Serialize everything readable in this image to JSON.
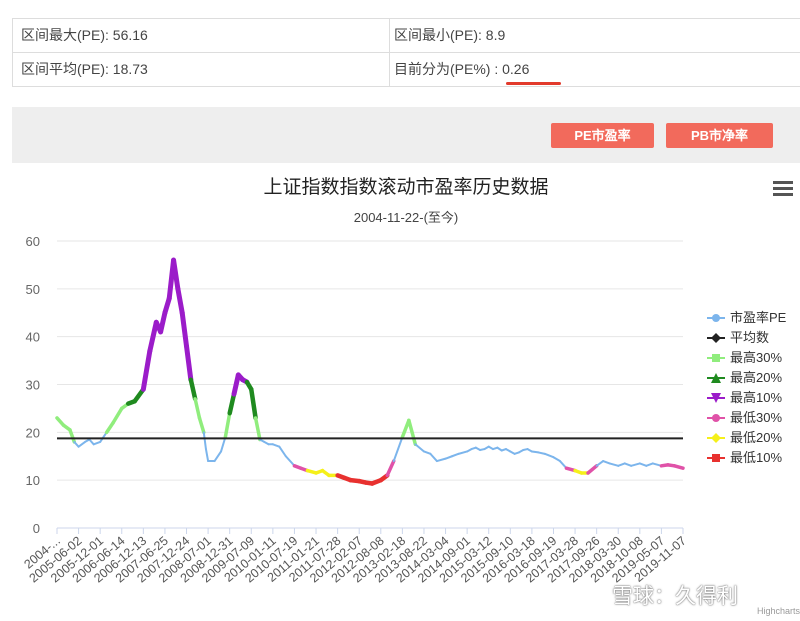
{
  "stats": {
    "max": "区间最大(PE): 56.16",
    "min": "区间最小(PE): 8.9",
    "avg": "区间平均(PE): 18.73",
    "current_label": "目前分为(PE%) : ",
    "current_value": "0.26"
  },
  "buttons": {
    "pe": "PE市盈率",
    "pb": "PB市净率"
  },
  "watermark": "雪球：久得利",
  "credit": "Highcharts.com",
  "colors": {
    "pe": "#7cb5ec",
    "avg": "#222222",
    "top30": "#90ed7d",
    "top20": "#1f8a1f",
    "top10": "#9b1cc9",
    "low30": "#e052a8",
    "low20": "#f5f01a",
    "low10": "#e8312f",
    "accent": "#f26a5c"
  },
  "chart_data": {
    "type": "line",
    "title": "上证指数指数滚动市盈率历史数据",
    "subtitle": "2004-11-22-(至今)",
    "ylim": [
      0,
      60
    ],
    "yticks": [
      0,
      10,
      20,
      30,
      40,
      50,
      60
    ],
    "xticks": [
      "2004-...",
      "2005-06-02",
      "2005-12-01",
      "2006-06-14",
      "2006-12-13",
      "2007-06-25",
      "2007-12-24",
      "2008-07-01",
      "2008-12-31",
      "2009-07-09",
      "2010-01-11",
      "2010-07-19",
      "2011-01-21",
      "2011-07-28",
      "2012-02-07",
      "2012-08-08",
      "2013-02-18",
      "2013-08-22",
      "2014-03-04",
      "2014-09-01",
      "2015-03-12",
      "2015-09-10",
      "2016-03-18",
      "2016-09-19",
      "2017-03-28",
      "2017-09-26",
      "2018-03-30",
      "2018-10-08",
      "2019-05-07",
      "2019-11-07"
    ],
    "average": 18.73,
    "grid": true,
    "legend_placement": "right",
    "series": [
      {
        "name": "市盈率PE",
        "x": [
          0,
          0.3,
          0.6,
          0.8,
          1,
          1.3,
          1.5,
          1.7,
          2,
          2.3,
          2.6,
          3,
          3.3,
          3.6,
          4,
          4.3,
          4.6,
          4.8,
          5,
          5.2,
          5.4,
          5.6,
          5.8,
          6,
          6.2,
          6.4,
          6.6,
          6.8,
          6.9,
          7,
          7.3,
          7.6,
          7.8,
          8,
          8.2,
          8.4,
          8.6,
          8.8,
          9,
          9.2,
          9.4,
          9.6,
          9.8,
          10,
          10.3,
          10.6,
          11,
          11.3,
          11.6,
          12,
          12.3,
          12.6,
          13,
          13.3,
          13.6,
          14,
          14.3,
          14.6,
          15,
          15.3,
          15.6,
          16,
          16.3,
          16.6,
          17,
          17.3,
          17.6,
          18,
          18.3,
          18.6,
          19,
          19.2,
          19.4,
          19.6,
          19.8,
          20,
          20.2,
          20.4,
          20.6,
          20.8,
          21,
          21.2,
          21.4,
          21.6,
          21.8,
          22,
          22.3,
          22.6,
          23,
          23.3,
          23.6,
          24,
          24.3,
          24.6,
          25,
          25.3,
          25.6,
          26,
          26.3,
          26.6,
          27,
          27.3,
          27.6,
          28,
          28.3,
          28.6,
          29
        ],
        "values": [
          23,
          21.5,
          20.5,
          18,
          17,
          18,
          18.5,
          17.5,
          18,
          20,
          22,
          25,
          26,
          26.5,
          29,
          37,
          43,
          41,
          45,
          48,
          56,
          50,
          45,
          38,
          31,
          27,
          23,
          20,
          16.5,
          14,
          14,
          16,
          19,
          24,
          28,
          32,
          31,
          30.5,
          29,
          23,
          18.5,
          18,
          17.5,
          17.5,
          17,
          15,
          13,
          12.5,
          12,
          11.5,
          12,
          11,
          11,
          10.5,
          10,
          9.8,
          9.5,
          9.3,
          10,
          11,
          14,
          19,
          22.5,
          17.5,
          16,
          15.5,
          14,
          14.5,
          15,
          15.5,
          16,
          16.5,
          16.8,
          16.3,
          16.5,
          17,
          16.5,
          16.8,
          16.2,
          16.5,
          16,
          15.5,
          15.8,
          16.3,
          16.5,
          16,
          15.8,
          15.5,
          14.8,
          14,
          12.5,
          12,
          11.5,
          11.5,
          13,
          14,
          13.5,
          13,
          13.5,
          13,
          13.5,
          13,
          13.5,
          13,
          13.2,
          13,
          12.5
        ]
      }
    ]
  }
}
